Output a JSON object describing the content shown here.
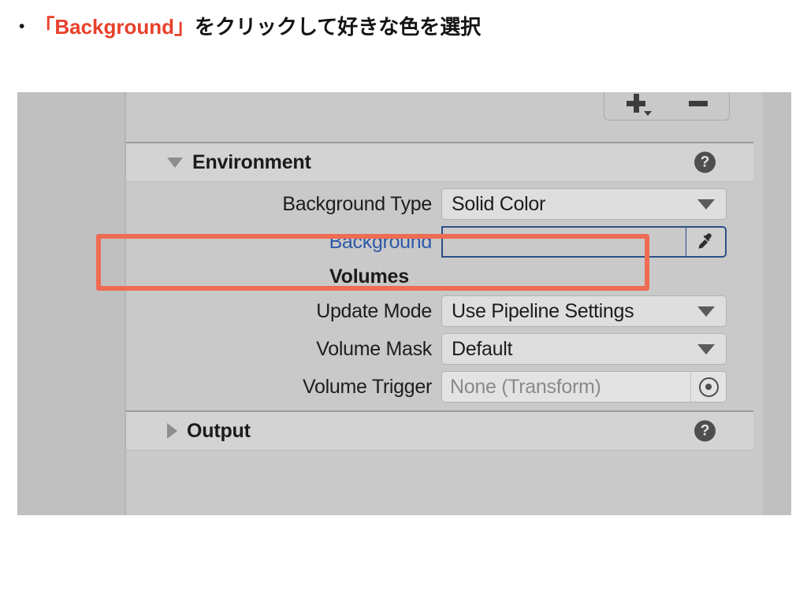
{
  "caption": {
    "bullet": "•",
    "emphasis": "「Background」",
    "rest": "をクリックして好きな色を選択",
    "emphasis_color": "#e8402a",
    "text_color": "#141414"
  },
  "inspector": {
    "toolbar": {
      "add_button_label": "+",
      "add_button_icon": "plus-icon",
      "add_button_caret_icon": "caret-down-mini-icon",
      "remove_button_label": "−",
      "remove_button_icon": "minus-icon"
    },
    "sections": [
      {
        "title": "Environment",
        "expanded": true,
        "disclosure_icon": "triangle-down-icon",
        "help_icon": "help-question-icon",
        "help_glyph": "?"
      },
      {
        "title": "Output",
        "expanded": false,
        "disclosure_icon": "triangle-right-icon",
        "help_icon": "help-question-icon",
        "help_glyph": "?"
      }
    ],
    "environment": {
      "background_type": {
        "label": "Background Type",
        "value": "Solid Color",
        "control": "dropdown",
        "caret_icon": "caret-down-icon"
      },
      "background": {
        "label": "Background",
        "label_color": "#2f5aa8",
        "swatch_color": "#000000",
        "swatch_border_color": "#2d4f87",
        "eyedropper_icon": "eyedropper-icon",
        "highlighted": true,
        "highlight_color": "#ef6b52"
      },
      "volumes_group_label": "Volumes",
      "update_mode": {
        "label": "Update Mode",
        "value": "Use Pipeline Settings",
        "control": "dropdown",
        "caret_icon": "caret-down-icon"
      },
      "volume_mask": {
        "label": "Volume Mask",
        "value": "Default",
        "control": "dropdown",
        "caret_icon": "caret-down-icon"
      },
      "volume_trigger": {
        "label": "Volume Trigger",
        "value": "None (Transform)",
        "control": "object-field",
        "picker_icon": "object-picker-target-icon"
      }
    },
    "colors": {
      "panel_background": "#c9c9c9",
      "header_background": "#d3d3d3",
      "field_background": "#dedede",
      "gutter": "#c0c0c0"
    }
  }
}
